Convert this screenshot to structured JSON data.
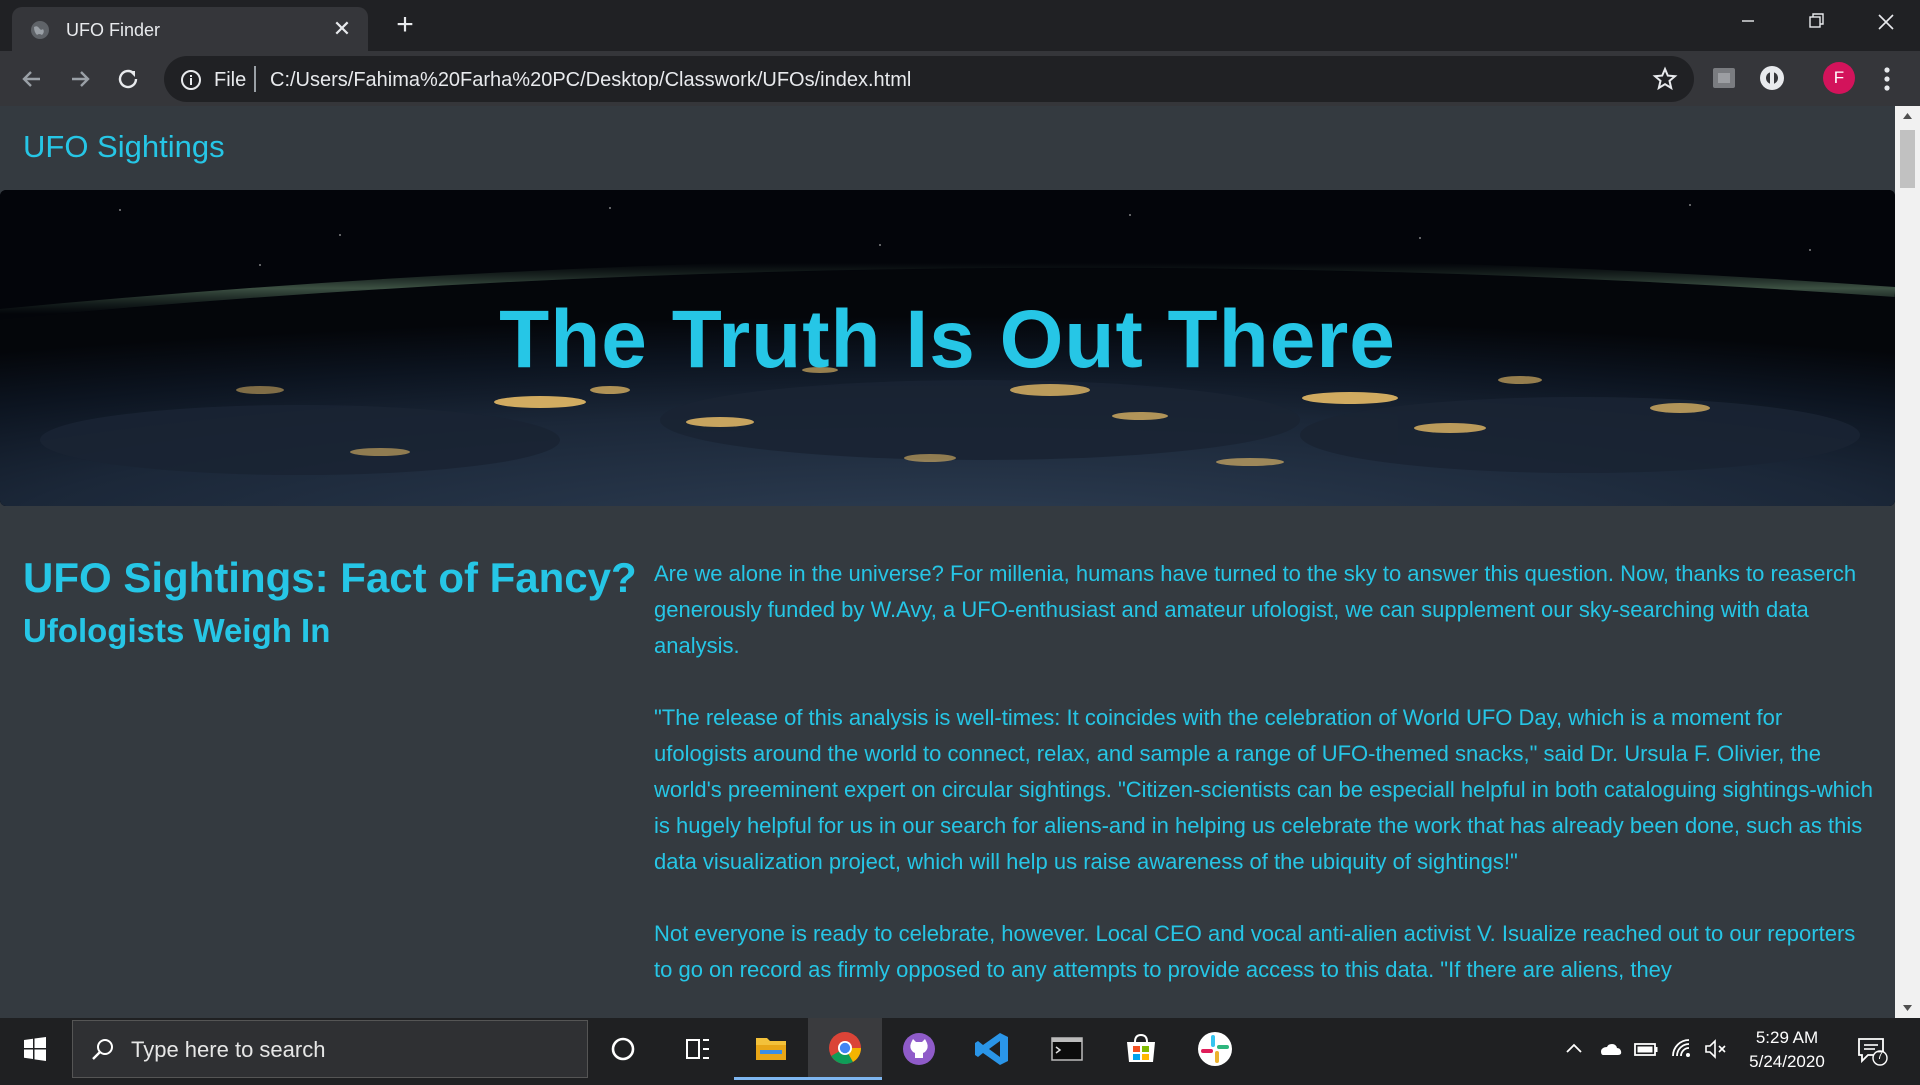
{
  "browser": {
    "tab_title": "UFO Finder",
    "url_scheme": "File",
    "url": "C:/Users/Fahima%20Farha%20PC/Desktop/Classwork/UFOs/index.html",
    "profile_initial": "F"
  },
  "page": {
    "brand": "UFO Sightings",
    "hero_title": "The Truth Is Out There",
    "side_title": "UFO Sightings: Fact of Fancy?",
    "side_subtitle": "Ufologists Weigh In",
    "paragraphs": [
      "Are we alone in the universe? For millenia, humans have turned to the sky to answer this question. Now, thanks to reaserch generously funded by W.Avy, a UFO-enthusiast and amateur ufologist, we can supplement our sky-searching with data analysis.",
      "\"The release of this analysis is well-times: It coincides with the celebration of World UFO Day, which is a moment for ufologists around the world to connect, relax, and sample a range of UFO-themed snacks,\" said Dr. Ursula F. Olivier, the world's preeminent expert on circular sightings. \"Citizen-scientists can be especiall helpful in both cataloguing sightings-which is hugely helpful for us in our search for aliens-and in helping us celebrate the work that has already been done, such as this data visualization project, which will help us raise awareness of the ubiquity of sightings!\"",
      "Not everyone is ready to celebrate, however. Local CEO and vocal anti-alien activist V. Isualize reached out to our reporters to go on record as firmly opposed to any attempts to provide access to this data. \"If there are aliens, they"
    ]
  },
  "taskbar": {
    "search_placeholder": "Type here to search",
    "time": "5:29 AM",
    "date": "5/24/2020",
    "notification_count": "7"
  },
  "colors": {
    "accent": "#26c6e6",
    "page_bg": "#343a40",
    "chrome_dark": "#202124",
    "chrome_toolbar": "#35363a",
    "profile": "#d3135b"
  }
}
